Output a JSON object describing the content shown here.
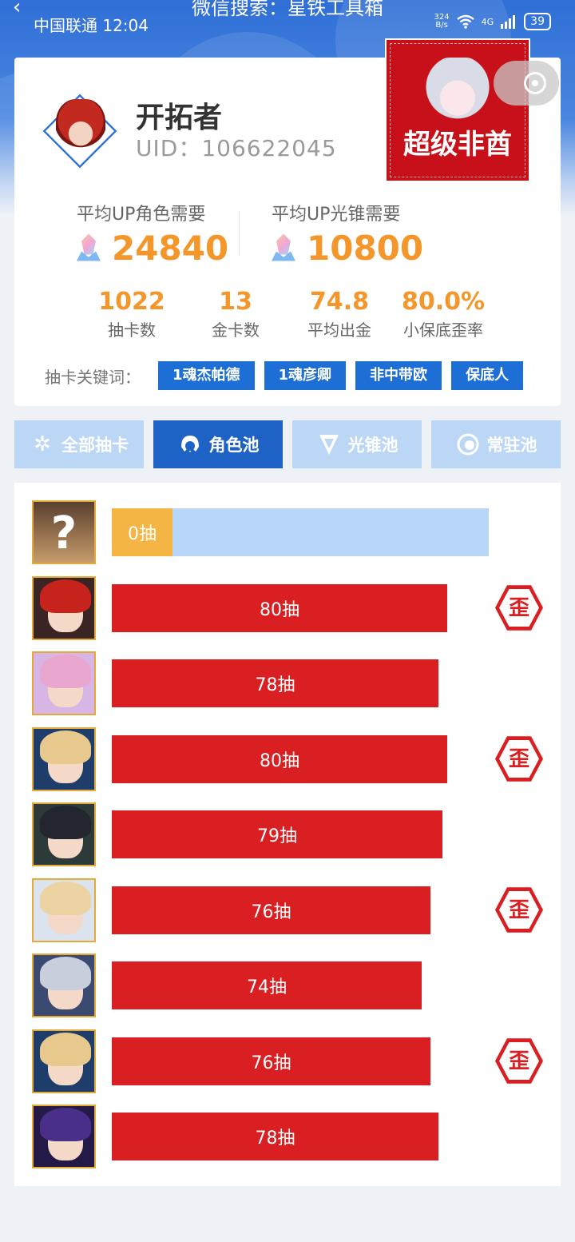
{
  "status_bar": {
    "carrier_time": "中国联通 12:04",
    "net_speed_value": "324",
    "net_speed_unit": "B/s",
    "network": "4G",
    "battery": "39"
  },
  "top_bar": {
    "title": "微信搜索：星铁工具箱"
  },
  "profile": {
    "name": "开拓者",
    "uid": "UID：106622045",
    "rating_badge": "超级非酋",
    "avg_up_character_label": "平均UP角色需要",
    "avg_up_character_value": "24840",
    "avg_up_lightcone_label": "平均UP光锥需要",
    "avg_up_lightcone_value": "10800",
    "stats": [
      {
        "value": "1022",
        "label": "抽卡数"
      },
      {
        "value": "13",
        "label": "金卡数"
      },
      {
        "value": "74.8",
        "label": "平均出金"
      },
      {
        "value": "80.0%",
        "label": "小保底歪率"
      }
    ],
    "keywords_label": "抽卡关键词：",
    "keywords": [
      "1魂杰帕德",
      "1魂彦卿",
      "非中带欧",
      "保底人"
    ]
  },
  "tabs": [
    {
      "label": "全部抽卡",
      "icon": "sparkle-icon",
      "active": false
    },
    {
      "label": "角色池",
      "icon": "character-icon",
      "active": true
    },
    {
      "label": "光锥池",
      "icon": "lightcone-icon",
      "active": false
    },
    {
      "label": "常驻池",
      "icon": "standard-icon",
      "active": false
    }
  ],
  "pulls": [
    {
      "label": "0抽",
      "pulls": 0,
      "pending": true,
      "wai": false,
      "portrait": "unknown"
    },
    {
      "label": "80抽",
      "pulls": 80,
      "wai": true,
      "portrait": "red-hair"
    },
    {
      "label": "78抽",
      "pulls": 78,
      "wai": false,
      "portrait": "pink-hair"
    },
    {
      "label": "80抽",
      "pulls": 80,
      "wai": true,
      "portrait": "blond-hair"
    },
    {
      "label": "79抽",
      "pulls": 79,
      "wai": false,
      "portrait": "dark-hair"
    },
    {
      "label": "76抽",
      "pulls": 76,
      "wai": true,
      "portrait": "light-blond-hair"
    },
    {
      "label": "74抽",
      "pulls": 74,
      "wai": false,
      "portrait": "silver-hair"
    },
    {
      "label": "76抽",
      "pulls": 76,
      "wai": true,
      "portrait": "blond-hair"
    },
    {
      "label": "78抽",
      "pulls": 78,
      "wai": false,
      "portrait": "purple-hair"
    }
  ],
  "wai_badge_text": "歪",
  "colors": {
    "accent_blue": "#1d6fd6",
    "bar_red": "#d91f22",
    "orange_value": "#f5962a",
    "pending_yellow": "#f5b544",
    "pending_track": "#b7d6f8"
  }
}
